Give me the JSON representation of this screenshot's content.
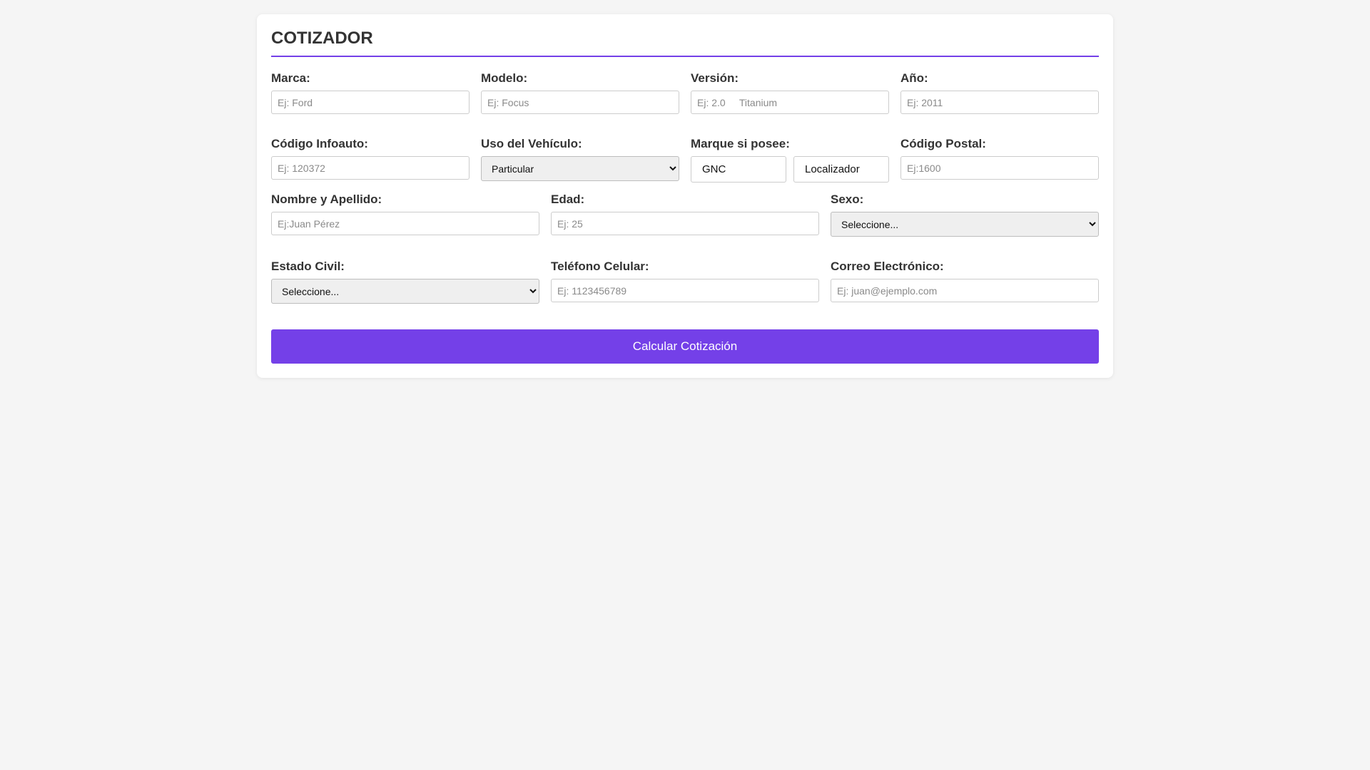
{
  "form": {
    "title": "COTIZADOR",
    "row1": {
      "marca": {
        "label": "Marca:",
        "placeholder": "Ej: Ford"
      },
      "modelo": {
        "label": "Modelo:",
        "placeholder": "Ej: Focus"
      },
      "version": {
        "label": "Versión:",
        "placeholder": "Ej: 2.0     Titanium"
      },
      "anio": {
        "label": "Año:",
        "placeholder": "Ej: 2011"
      }
    },
    "row2": {
      "codigo_infoauto": {
        "label": "Código Infoauto:",
        "placeholder": "Ej: 120372"
      },
      "uso_vehiculo": {
        "label": "Uso del Vehículo:",
        "selected": "Particular"
      },
      "marque_si_posee": {
        "label": "Marque si posee:",
        "options": [
          "GNC",
          "Localizador"
        ]
      },
      "codigo_postal": {
        "label": "Código Postal:",
        "placeholder": "Ej:1600"
      }
    },
    "row3": {
      "nombre_apellido": {
        "label": "Nombre y Apellido:",
        "placeholder": "Ej:Juan Pérez"
      },
      "edad": {
        "label": "Edad:",
        "placeholder": "Ej: 25"
      },
      "sexo": {
        "label": "Sexo:",
        "selected": "Seleccione..."
      }
    },
    "row4": {
      "estado_civil": {
        "label": "Estado Civil:",
        "selected": "Seleccione..."
      },
      "telefono": {
        "label": "Teléfono Celular:",
        "placeholder": "Ej: 1123456789"
      },
      "correo": {
        "label": "Correo Electrónico:",
        "placeholder": "Ej: juan@ejemplo.com"
      }
    },
    "submit_label": "Calcular Cotización"
  },
  "colors": {
    "accent": "#7440e8",
    "background": "#f5f5f5",
    "card": "#ffffff"
  }
}
